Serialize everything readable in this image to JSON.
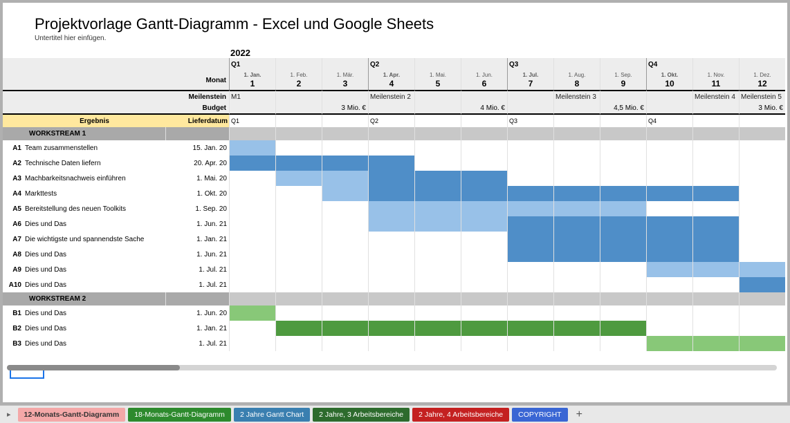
{
  "title": "Projektvorlage Gantt-Diagramm - Excel und Google Sheets",
  "subtitle": "Untertitel hier einfügen.",
  "year": "2022",
  "headers": {
    "monat": "Monat",
    "meilenstein": "Meilenstein",
    "budget": "Budget",
    "ergebnis": "Ergebnis",
    "lieferdatum": "Lieferdatum"
  },
  "quarters": [
    "Q1",
    "Q2",
    "Q3",
    "Q4"
  ],
  "months": [
    {
      "date": "1. Jan.",
      "num": "1"
    },
    {
      "date": "1. Feb.",
      "num": "2"
    },
    {
      "date": "1. Mär.",
      "num": "3"
    },
    {
      "date": "1. Apr.",
      "num": "4"
    },
    {
      "date": "1. Mai.",
      "num": "5"
    },
    {
      "date": "1. Jun.",
      "num": "6"
    },
    {
      "date": "1. Jul.",
      "num": "7"
    },
    {
      "date": "1. Aug.",
      "num": "8"
    },
    {
      "date": "1. Sep.",
      "num": "9"
    },
    {
      "date": "1. Okt.",
      "num": "10"
    },
    {
      "date": "1. Nov.",
      "num": "11"
    },
    {
      "date": "1. Dez.",
      "num": "12"
    }
  ],
  "milestones": [
    "",
    "M1",
    "",
    "",
    "Meilenstein 2",
    "",
    "",
    "",
    "Meilenstein 3",
    "",
    "",
    "Meilenstein 4",
    "Meilenstein 5"
  ],
  "budgets": [
    "",
    "",
    "",
    "3 Mio. €",
    "",
    "",
    "4 Mio. €",
    "",
    "",
    "4,5 Mio. €",
    "",
    "",
    "3 Mio. €"
  ],
  "ergebnis_row": [
    "",
    "Q1",
    "",
    "",
    "Q2",
    "",
    "",
    "Q3",
    "",
    "",
    "Q4",
    "",
    ""
  ],
  "ws": [
    {
      "name": "WORKSTREAM 1",
      "tasks": [
        {
          "id": "A1",
          "name": "Team zusammenstellen",
          "date": "15. Jan. 20",
          "bars": [
            {
              "s": 0,
              "e": 1,
              "c": "l"
            }
          ]
        },
        {
          "id": "A2",
          "name": "Technische Daten liefern",
          "date": "20. Apr. 20",
          "bars": [
            {
              "s": 0,
              "e": 4,
              "c": "d"
            }
          ]
        },
        {
          "id": "A3",
          "name": "Machbarkeitsnachweis einführen",
          "date": "1. Mai. 20",
          "bars": [
            {
              "s": 1,
              "e": 3,
              "c": "l"
            },
            {
              "s": 3,
              "e": 6,
              "c": "d"
            }
          ]
        },
        {
          "id": "A4",
          "name": "Markttests",
          "date": "1. Okt. 20",
          "bars": [
            {
              "s": 2,
              "e": 3,
              "c": "l"
            },
            {
              "s": 3,
              "e": 11,
              "c": "d"
            }
          ]
        },
        {
          "id": "A5",
          "name": "Bereitstellung des neuen Toolkits",
          "date": "1. Sep. 20",
          "bars": [
            {
              "s": 3,
              "e": 9,
              "c": "l"
            }
          ]
        },
        {
          "id": "A6",
          "name": "Dies und Das",
          "date": "1. Jun. 21",
          "bars": [
            {
              "s": 3,
              "e": 6,
              "c": "l"
            },
            {
              "s": 6,
              "e": 11,
              "c": "d"
            }
          ]
        },
        {
          "id": "A7",
          "name": "Die wichtigste und spannendste Sache",
          "date": "1. Jan. 21",
          "bars": [
            {
              "s": 6,
              "e": 11,
              "c": "d"
            }
          ]
        },
        {
          "id": "A8",
          "name": "Dies und Das",
          "date": "1. Jun. 21",
          "bars": [
            {
              "s": 6,
              "e": 11,
              "c": "d"
            }
          ]
        },
        {
          "id": "A9",
          "name": "Dies und Das",
          "date": "1. Jul. 21",
          "bars": [
            {
              "s": 9,
              "e": 11,
              "c": "l"
            },
            {
              "s": 11,
              "e": 12,
              "c": "l"
            }
          ]
        },
        {
          "id": "A10",
          "name": "Dies und Das",
          "date": "1. Jul. 21",
          "bars": [
            {
              "s": 11,
              "e": 12,
              "c": "d"
            }
          ]
        }
      ]
    },
    {
      "name": "WORKSTREAM 2",
      "tasks": [
        {
          "id": "B1",
          "name": "Dies und Das",
          "date": "1. Jun. 20",
          "bars": [
            {
              "s": 0,
              "e": 1,
              "c": "g"
            }
          ]
        },
        {
          "id": "B2",
          "name": "Dies und Das",
          "date": "1. Jan. 21",
          "bars": [
            {
              "s": 1,
              "e": 9,
              "c": "gd"
            }
          ]
        },
        {
          "id": "B3",
          "name": "Dies und Das",
          "date": "1. Jul. 21",
          "bars": [
            {
              "s": 9,
              "e": 12,
              "c": "g"
            }
          ]
        }
      ]
    }
  ],
  "tabs": [
    {
      "label": "12-Monats-Gantt-Diagramm",
      "cls": "active"
    },
    {
      "label": "18-Monats-Gantt-Diagramm",
      "cls": "green"
    },
    {
      "label": "2 Jahre Gantt Chart",
      "cls": "blue1"
    },
    {
      "label": "2 Jahre, 3 Arbeitsbereiche",
      "cls": "green2"
    },
    {
      "label": "2 Jahre, 4 Arbeitsbereiche",
      "cls": "red"
    },
    {
      "label": "COPYRIGHT",
      "cls": "blue2"
    }
  ]
}
